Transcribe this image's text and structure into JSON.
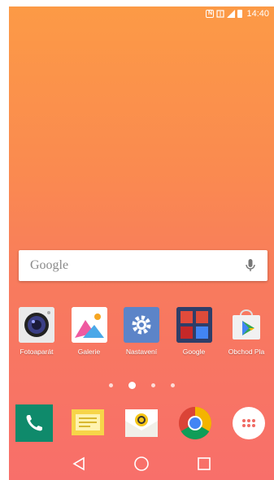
{
  "status_bar": {
    "time": "14:40",
    "icons": [
      "nfc-icon",
      "dual-sim-icon",
      "signal-icon",
      "battery-icon"
    ]
  },
  "search": {
    "logo": "Google",
    "icon": "mic-icon"
  },
  "apps": [
    {
      "label": "Fotoaparát",
      "icon": "camera-icon"
    },
    {
      "label": "Galerie",
      "icon": "gallery-icon"
    },
    {
      "label": "Nastavení",
      "icon": "settings-gear-icon"
    },
    {
      "label": "Google",
      "icon": "google-folder-icon"
    },
    {
      "label": "Obchod Pla",
      "icon": "play-store-icon"
    }
  ],
  "page_indicator": {
    "pages": 4,
    "active": 1
  },
  "dock": [
    {
      "name": "phone",
      "icon": "phone-icon"
    },
    {
      "name": "messages",
      "icon": "message-icon"
    },
    {
      "name": "email",
      "icon": "email-icon"
    },
    {
      "name": "chrome",
      "icon": "chrome-icon"
    },
    {
      "name": "apps-drawer",
      "icon": "apps-grid-icon"
    }
  ],
  "navigation": [
    "back-icon",
    "home-icon",
    "recents-icon"
  ],
  "colors": {
    "wallpaper_top": "#fc9a46",
    "wallpaper_bottom": "#f86f6a",
    "phone_green": "#0f8a6b",
    "message_yellow": "#f7d549"
  }
}
